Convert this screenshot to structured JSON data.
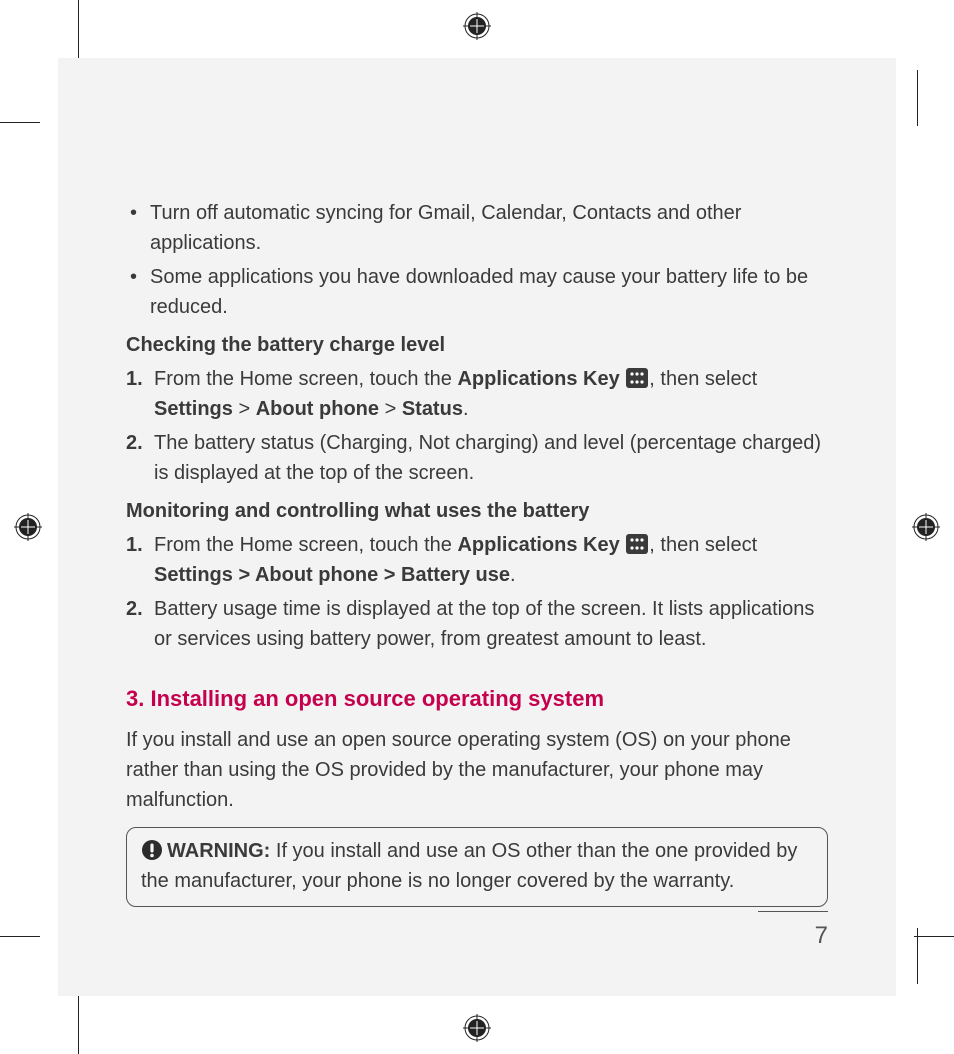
{
  "bullets": [
    "Turn off automatic syncing for Gmail, Calendar, Contacts and other applications.",
    "Some applications you have downloaded may cause your battery life to be reduced."
  ],
  "check_level": {
    "heading": "Checking the battery charge level",
    "step1_a": "From the Home screen, touch the ",
    "step1_appkey": "Applications Key",
    "step1_b": ", then select ",
    "step1_path_settings": "Settings",
    "step1_sep": " > ",
    "step1_path_about": "About phone",
    "step1_path_status": "Status",
    "step1_end": ".",
    "step2": "The battery status (Charging, Not charging) and level (percentage charged) is displayed at the top of the screen."
  },
  "monitor": {
    "heading": "Monitoring and controlling what uses the battery",
    "step1_a": "From the Home screen, touch the ",
    "step1_appkey": "Applications Key",
    "step1_b": ", then select ",
    "step1_path": "Settings > About phone > Battery use",
    "step1_end": ".",
    "step2": "Battery usage time is displayed at the top of the screen. It lists applications or services using battery power, from greatest amount to least."
  },
  "section3": {
    "title": "3. Installing an open source operating system",
    "body": "If you install and use an open source operating system (OS) on your phone rather than using the OS provided by the manufacturer, your phone may malfunction."
  },
  "warning": {
    "label": "WARNING:",
    "text": " If you install and use an OS other than the one provided by the manufacturer, your phone is no longer covered by the warranty."
  },
  "page_number": "7"
}
